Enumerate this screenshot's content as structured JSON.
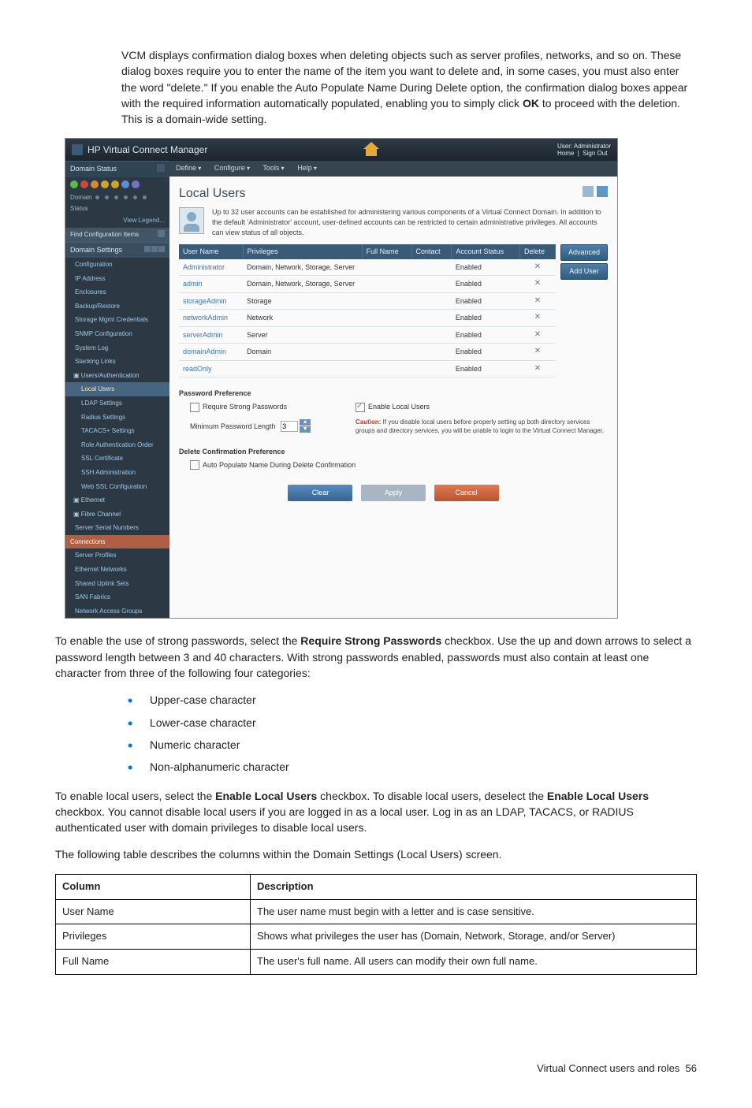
{
  "intro_p1_a": "VCM displays confirmation dialog boxes when deleting objects such as server profiles, networks, and so on. These dialog boxes require you to enter the name of the item you want to delete and, in some cases, you must also enter the word \"delete.\" If you enable the Auto Populate Name During Delete option, the confirmation dialog boxes appear with the required information automatically populated, enabling you to simply click ",
  "intro_ok": "OK",
  "intro_p1_b": " to proceed with the deletion. This is a domain-wide setting.",
  "shot": {
    "title": "HP Virtual Connect Manager",
    "user_label": "User: Administrator",
    "home_label": "Home",
    "signout_label": "Sign Out",
    "menus": [
      "Define",
      "Configure",
      "Tools",
      "Help"
    ],
    "page_title": "Local Users",
    "info_text": "Up to 32 user accounts can be established for administering various components of a Virtual Connect Domain. In addition to the default 'Administrator' account, user-defined accounts can be restricted to certain administrative privileges. All accounts can view status of all objects.",
    "cols": {
      "user": "User Name",
      "priv": "Privileges",
      "full": "Full Name",
      "contact": "Contact",
      "status": "Account Status",
      "del": "Delete"
    },
    "rows": [
      {
        "u": "Administrator",
        "p": "Domain, Network, Storage, Server",
        "f": "",
        "c": "",
        "s": "Enabled",
        "d": "✕"
      },
      {
        "u": "admin",
        "p": "Domain, Network, Storage, Server",
        "f": "",
        "c": "",
        "s": "Enabled",
        "d": "✕"
      },
      {
        "u": "storageAdmin",
        "p": "Storage",
        "f": "",
        "c": "",
        "s": "Enabled",
        "d": "✕"
      },
      {
        "u": "networkAdmin",
        "p": "Network",
        "f": "",
        "c": "",
        "s": "Enabled",
        "d": "✕"
      },
      {
        "u": "serverAdmin",
        "p": "Server",
        "f": "",
        "c": "",
        "s": "Enabled",
        "d": "✕"
      },
      {
        "u": "domainAdmin",
        "p": "Domain",
        "f": "",
        "c": "",
        "s": "Enabled",
        "d": "✕"
      },
      {
        "u": "readOnly",
        "p": "",
        "f": "",
        "c": "",
        "s": "Enabled",
        "d": "✕"
      }
    ],
    "btn_advanced": "Advanced",
    "btn_adduser": "Add User",
    "pwd_pref_title": "Password Preference",
    "cb_strong": "Require Strong Passwords",
    "min_len_label": "Minimum Password Length",
    "min_len_value": "3",
    "enable_local": "Enable Local Users",
    "caution_label": "Caution:",
    "caution_text": " If you disable local users before properly setting up both directory services groups and directory services, you will be unable to login to the Virtual Connect Manager.",
    "del_pref_title": "Delete Confirmation Preference",
    "cb_autopop": "Auto Populate Name During Delete Confirmation",
    "btn_clear": "Clear",
    "btn_apply": "Apply",
    "btn_cancel": "Cancel",
    "sidebar": {
      "domain_status": "Domain Status",
      "domain_label": "Domain",
      "status_label": "Status",
      "legend": "View Legend...",
      "find": "Find Configuration Items",
      "domain_settings": "Domain Settings",
      "items_ds": [
        "Configuration",
        "IP Address",
        "Enclosures",
        "Backup/Restore",
        "Storage Mgmt Credentials",
        "SNMP Configuration",
        "System Log",
        "Stacking Links"
      ],
      "users_auth": "Users/Authentication",
      "items_ua": [
        "Local Users",
        "LDAP Settings",
        "Radius Settings",
        "TACACS+ Settings",
        "Role Authentication Order",
        "SSL Certificate",
        "SSH Administration",
        "Web SSL Configuration"
      ],
      "ethernet": "Ethernet",
      "fibre": "Fibre Channel",
      "serial": "Server Serial Numbers",
      "connections": "Connections",
      "items_conn": [
        "Server Profiles",
        "Ethernet Networks",
        "Shared Uplink Sets",
        "SAN Fabrics",
        "Network Access Groups"
      ]
    }
  },
  "p2_a": "To enable the use of strong passwords, select the ",
  "p2_b": "Require Strong Passwords",
  "p2_c": " checkbox. Use the up and down arrows to select a password length between 3 and 40 characters. With strong passwords enabled, passwords must also contain at least one character from three of the following four categories:",
  "bullets": [
    "Upper-case character",
    "Lower-case character",
    "Numeric character",
    "Non-alphanumeric character"
  ],
  "p3_a": "To enable local users, select the ",
  "p3_b": "Enable Local Users",
  "p3_c": " checkbox. To disable local users, deselect the ",
  "p3_d": "Enable Local Users",
  "p3_e": " checkbox. You cannot disable local users if you are logged in as a local user. Log in as an LDAP, TACACS, or RADIUS authenticated user with domain privileges to disable local users.",
  "p4": "The following table describes the columns within the Domain Settings (Local Users) screen.",
  "table": {
    "h1": "Column",
    "h2": "Description",
    "rows": [
      {
        "c": "User Name",
        "d": "The user name must begin with a letter and is case sensitive."
      },
      {
        "c": "Privileges",
        "d": "Shows what privileges the user has (Domain, Network, Storage, and/or Server)"
      },
      {
        "c": "Full Name",
        "d": "The user's full name. All users can modify their own full name."
      }
    ]
  },
  "footer_text": "Virtual Connect users and roles",
  "footer_page": "56"
}
